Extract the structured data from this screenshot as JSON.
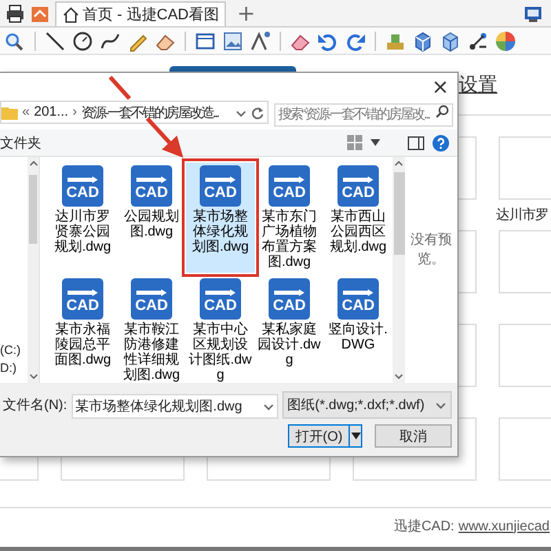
{
  "tabs": [
    {
      "label": "首页 - 迅捷CAD看图",
      "selected": true
    }
  ],
  "new_tab": "+",
  "home": {
    "settings_link": "设置",
    "thumbnail_caption": "达川市罗",
    "footer": {
      "label": "迅捷CAD:",
      "link": "www.xunjiecad"
    }
  },
  "dialog": {
    "close": "×",
    "address": {
      "overflow": "«",
      "crumbs": [
        "201...",
        "资源-一套不错的房屋改造..."
      ],
      "separator": "›"
    },
    "search": {
      "placeholder": "搜索“资源-一套不错的房屋改..."
    },
    "toolbar_label": "文件夹",
    "nav_items": [
      {
        "label": "(C:)"
      },
      {
        "label": "D:)"
      }
    ],
    "files": [
      {
        "icon_label": "CAD",
        "name": "达川市罗贤寨公园规划.dwg",
        "selected": false
      },
      {
        "icon_label": "CAD",
        "name": "公园规划图.dwg",
        "selected": false
      },
      {
        "icon_label": "CAD",
        "name": "某市场整体绿化规划图.dwg",
        "selected": true
      },
      {
        "icon_label": "CAD",
        "name": "某市东门广场植物布置方案图.dwg",
        "selected": false
      },
      {
        "icon_label": "CAD",
        "name": "某市西山公园西区规划.dwg",
        "selected": false
      },
      {
        "icon_label": "CAD",
        "name": "某市永福陵园总平面图.dwg",
        "selected": false
      },
      {
        "icon_label": "CAD",
        "name": "某市鞍江防港修建性详细规划图.dwg",
        "selected": false
      },
      {
        "icon_label": "CAD",
        "name": "某市中心区规划设计图纸.dwg",
        "selected": false
      },
      {
        "icon_label": "CAD",
        "name": "某私家庭园设计.dwg",
        "selected": false
      },
      {
        "icon_label": "CAD",
        "name": "竖向设计.DWG",
        "selected": false
      }
    ],
    "preview_text": "没有预览。",
    "filename": {
      "label": "文件名(N):",
      "value": "某市场整体绿化规划图.dwg"
    },
    "filter": "图纸(*.dwg;*.dxf;*.dwf)",
    "buttons": [
      {
        "kind": "split",
        "label": "打开(O)"
      },
      {
        "kind": "plain",
        "label": "取消"
      }
    ]
  }
}
